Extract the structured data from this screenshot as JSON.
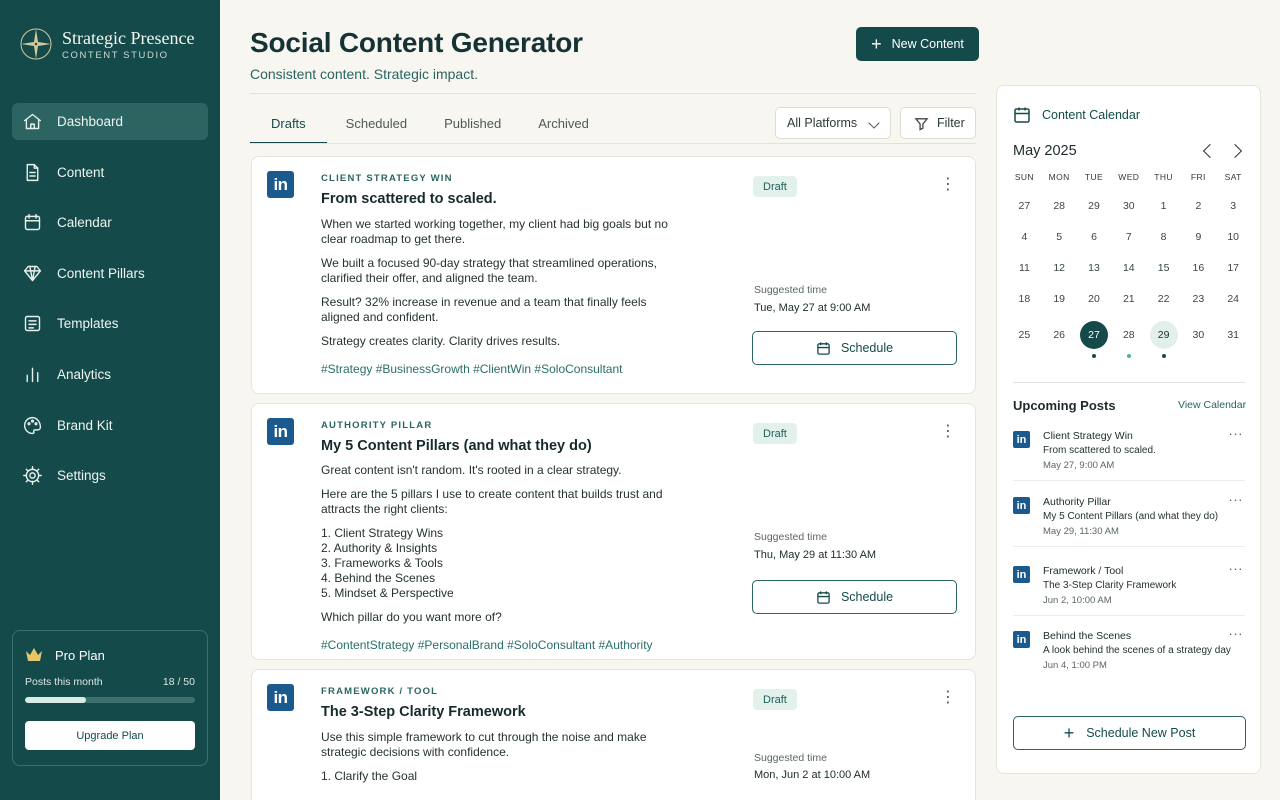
{
  "brand": {
    "name": "Strategic Presence",
    "sub": "CONTENT STUDIO"
  },
  "nav": [
    {
      "label": "Dashboard",
      "icon": "home-icon",
      "active": true
    },
    {
      "label": "Content",
      "icon": "document-icon"
    },
    {
      "label": "Calendar",
      "icon": "calendar-icon"
    },
    {
      "label": "Content Pillars",
      "icon": "diamond-icon"
    },
    {
      "label": "Templates",
      "icon": "templates-icon"
    },
    {
      "label": "Analytics",
      "icon": "analytics-icon"
    },
    {
      "label": "Brand Kit",
      "icon": "palette-icon"
    },
    {
      "label": "Settings",
      "icon": "gear-icon"
    }
  ],
  "plan": {
    "name": "Pro Plan",
    "posts_label": "Posts this month",
    "posts_value": "18 / 50",
    "progress": 0.36,
    "upgrade": "Upgrade Plan"
  },
  "header": {
    "title": "Social Content Generator",
    "tagline": "Consistent content. Strategic impact.",
    "new_button": "New Content"
  },
  "tabs": [
    "Drafts",
    "Scheduled",
    "Published",
    "Archived"
  ],
  "filters": {
    "platform": "All Platforms",
    "filter": "Filter"
  },
  "cards": [
    {
      "pillar": "CLIENT STRATEGY WIN",
      "title": "From scattered to scaled.",
      "paragraphs": [
        "When we started working together, my client had big goals but no\nclear roadmap to get there.",
        "We built a focused 90-day strategy that streamlined operations,\nclarified their offer, and aligned the team.",
        "Result? 32% increase in revenue and a team that finally feels\naligned and confident.",
        "Strategy creates clarity. Clarity drives results."
      ],
      "tags": "#Strategy #BusinessGrowth #ClientWin #SoloConsultant",
      "status": "Draft",
      "suggested_label": "Suggested time",
      "suggested_time": "Tue, May 27 at 9:00 AM",
      "schedule": "Schedule"
    },
    {
      "pillar": "AUTHORITY PILLAR",
      "title": "My 5 Content Pillars (and what they do)",
      "paragraphs": [
        "Great content isn't random. It's rooted in a clear strategy.",
        "Here are the 5 pillars I use to create content that builds trust and\nattracts the right clients:",
        "1. Client Strategy Wins\n2. Authority & Insights\n3. Frameworks & Tools\n4. Behind the Scenes\n5. Mindset & Perspective",
        "Which pillar do you want more of?"
      ],
      "tags": "#ContentStrategy #PersonalBrand #SoloConsultant #Authority",
      "status": "Draft",
      "suggested_label": "Suggested time",
      "suggested_time": "Thu, May 29 at 11:30 AM",
      "schedule": "Schedule"
    },
    {
      "pillar": "FRAMEWORK / TOOL",
      "title": "The 3-Step Clarity Framework",
      "paragraphs": [
        "Use this simple framework to cut through the noise and make\nstrategic decisions with confidence.",
        "1. Clarify the Goal"
      ],
      "tags": "",
      "status": "Draft",
      "suggested_label": "Suggested time",
      "suggested_time": "Mon, Jun 2 at 10:00 AM",
      "schedule": ""
    }
  ],
  "calendar": {
    "heading": "Content Calendar",
    "month": "May 2025",
    "weekdays": [
      "SUN",
      "MON",
      "TUE",
      "WED",
      "THU",
      "FRI",
      "SAT"
    ],
    "weeks": [
      [
        "27",
        "28",
        "29",
        "30",
        "1",
        "2",
        "3"
      ],
      [
        "4",
        "5",
        "6",
        "7",
        "8",
        "9",
        "10"
      ],
      [
        "11",
        "12",
        "13",
        "14",
        "15",
        "16",
        "17"
      ],
      [
        "18",
        "19",
        "20",
        "21",
        "22",
        "23",
        "24"
      ],
      [
        "25",
        "26",
        "27",
        "28",
        "29",
        "30",
        "31"
      ]
    ],
    "today": "27",
    "selected": "29",
    "dots": {
      "27": "dark",
      "28": "light",
      "29": "dark"
    }
  },
  "upcoming": {
    "title": "Upcoming Posts",
    "view_all": "View Calendar",
    "items": [
      {
        "pillar": "Client Strategy Win",
        "title": "From scattered to scaled.",
        "time": "May 27, 9:00 AM"
      },
      {
        "pillar": "Authority Pillar",
        "title": "My 5 Content Pillars (and what they do)",
        "time": "May 29, 11:30 AM"
      },
      {
        "pillar": "Framework / Tool",
        "title": "The 3-Step Clarity Framework",
        "time": "Jun 2, 10:00 AM"
      },
      {
        "pillar": "Behind the Scenes",
        "title": "A look behind the scenes of a strategy day",
        "time": "Jun 4, 1:00 PM"
      }
    ],
    "schedule_new": "Schedule New Post"
  },
  "colors": {
    "sidebar": "#144b4a",
    "accent": "#144b4a",
    "linkedin": "#1a5a8e",
    "badge_bg": "#e3f1ec"
  }
}
